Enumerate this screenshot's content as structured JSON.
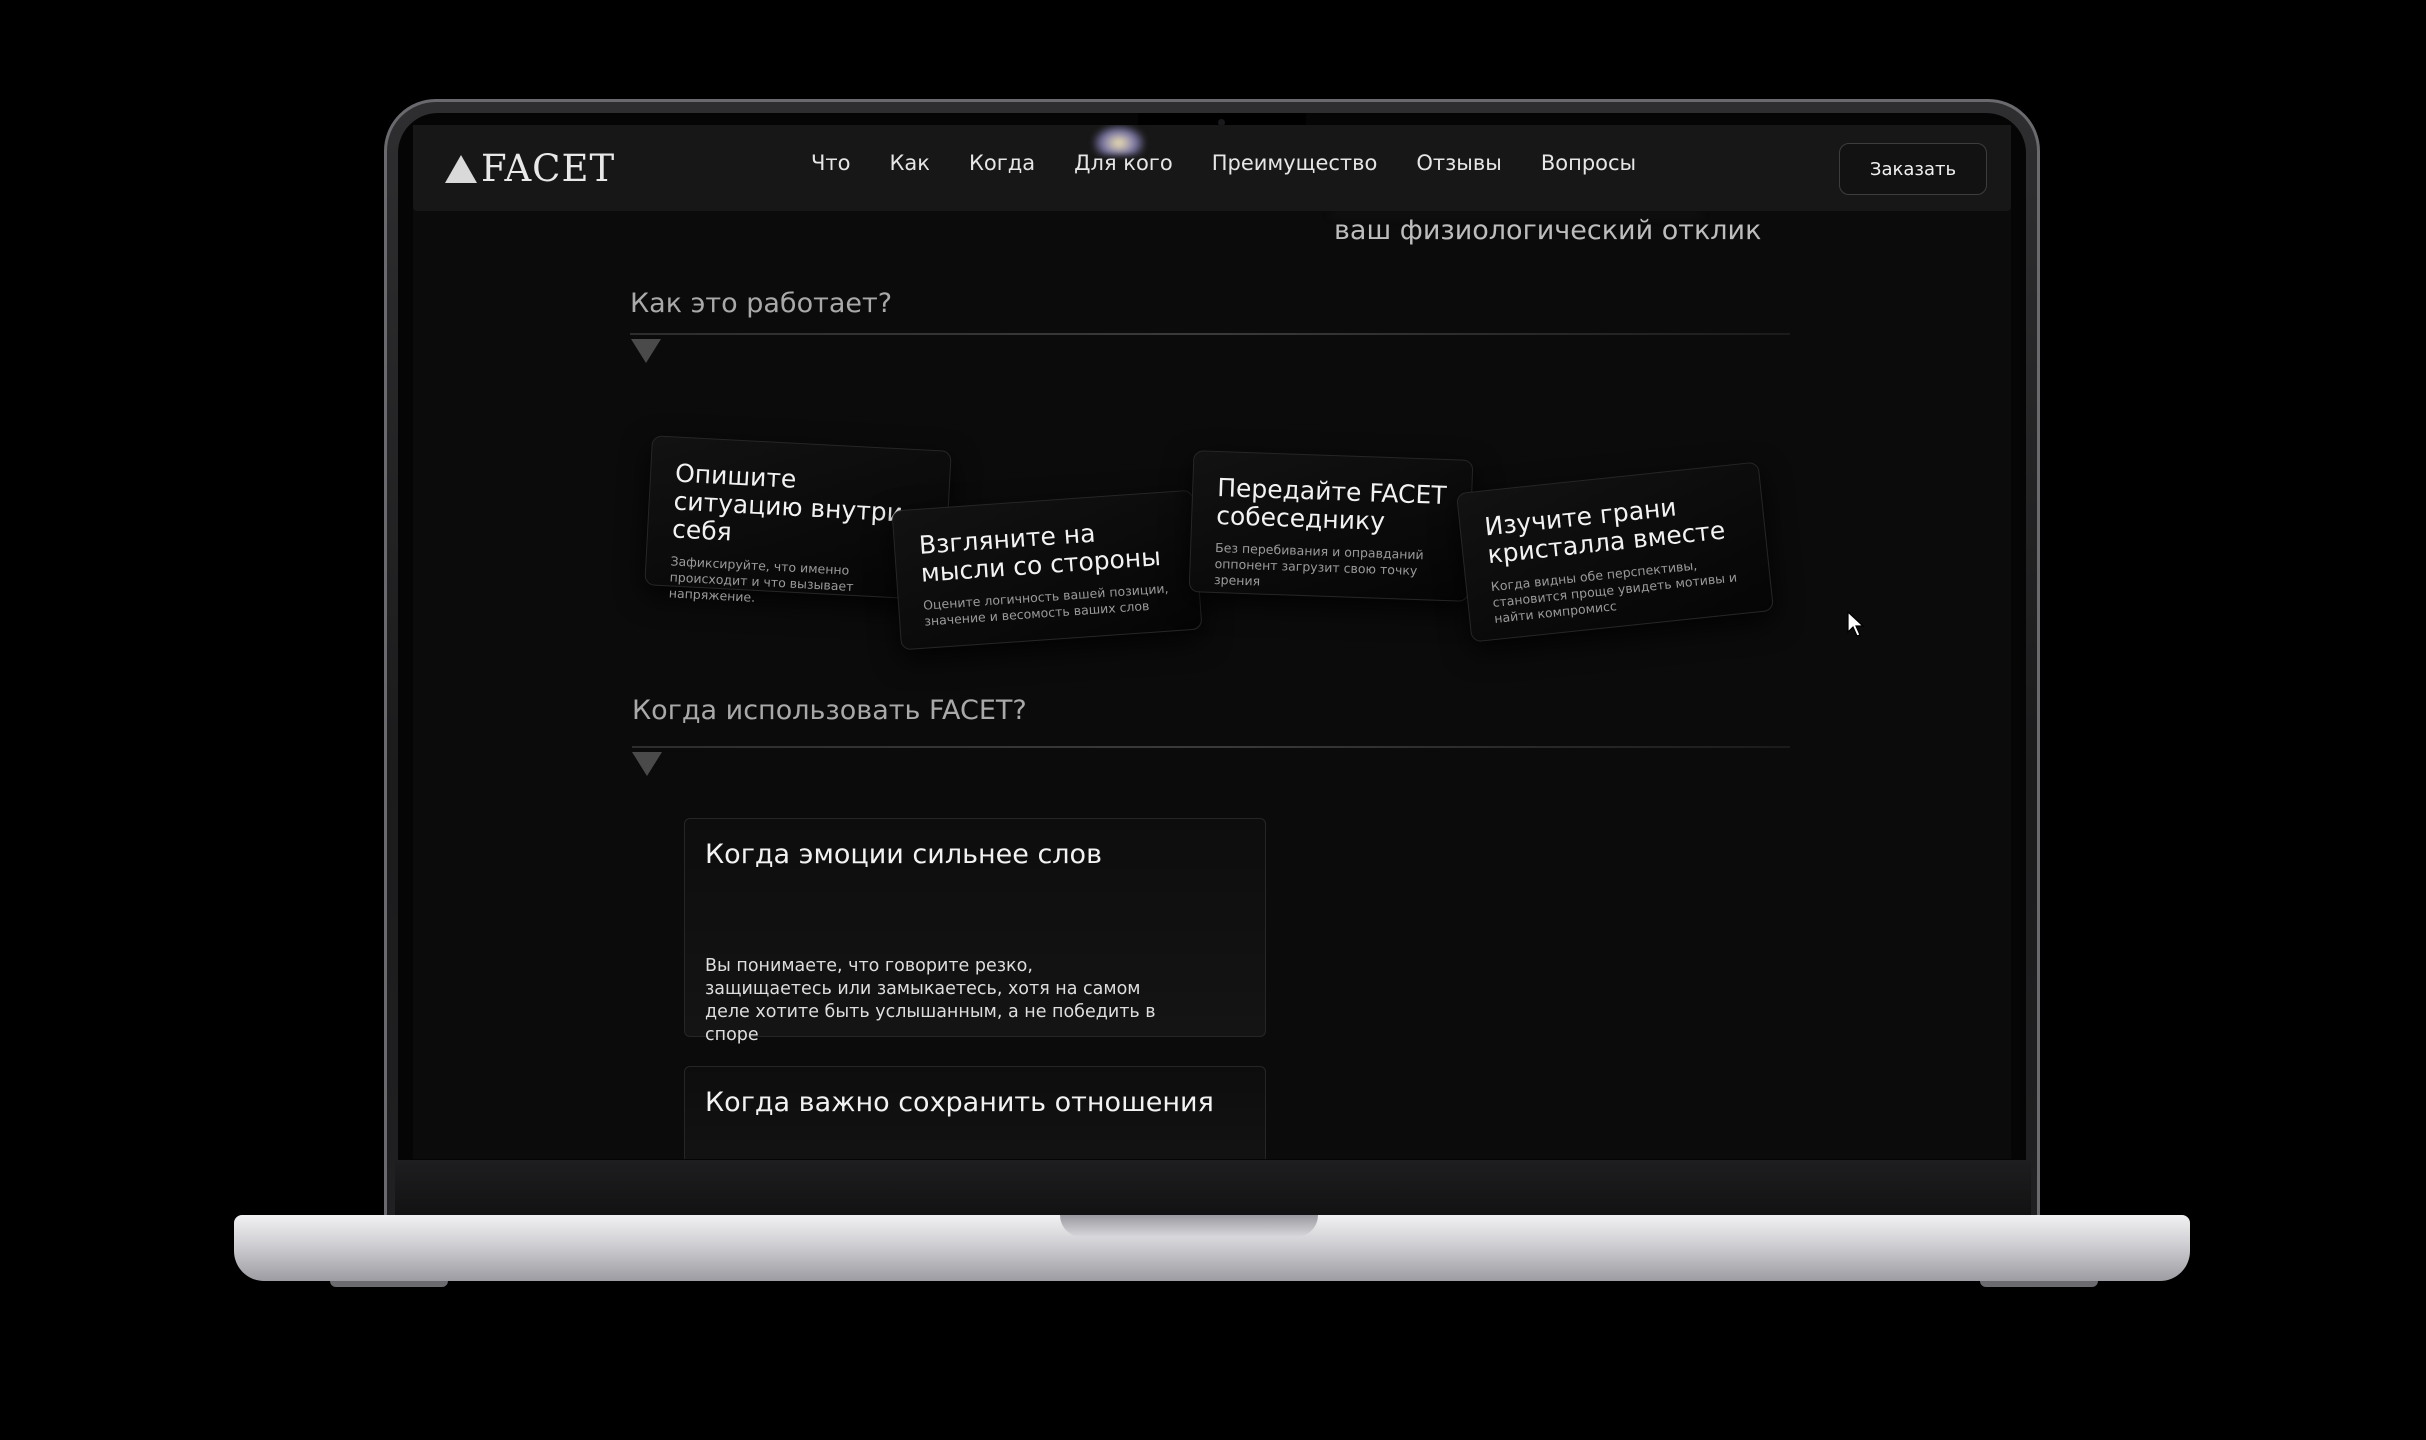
{
  "header": {
    "logo_text": "FACET",
    "nav": [
      "Что",
      "Как",
      "Когда",
      "Для кого",
      "Преимущество",
      "Отзывы",
      "Вопросы"
    ],
    "order_button": "Заказать"
  },
  "hero": {
    "tail_text": "ваш физиологический отклик"
  },
  "how_it_works": {
    "title": "Как это работает?",
    "steps": [
      {
        "title": "Опишите ситуацию внутри себя",
        "desc": "Зафиксируйте, что именно происходит и что вызывает напряжение."
      },
      {
        "title": "Взгляните на мысли со стороны",
        "desc": "Оцените логичность вашей позиции, значение и весомость ваших слов"
      },
      {
        "title": "Передайте FACET собеседнику",
        "desc": "Без перебивания и оправданий оппонент загрузит свою точку зрения"
      },
      {
        "title": "Изучите грани кристалла вместе",
        "desc": "Когда видны обе перспективы, становится проще увидеть мотивы и найти компромисс"
      }
    ]
  },
  "when_to_use": {
    "title": "Когда использовать FACET?",
    "cards": [
      {
        "title": "Когда эмоции сильнее слов",
        "desc": "Вы понимаете, что говорите резко, защищаетесь или замыкаетесь, хотя на самом деле хотите быть услышанным, а не победить в споре"
      },
      {
        "title": "Когда важно сохранить отношения",
        "desc": ""
      }
    ]
  },
  "colors": {
    "background": "#0b0b0b",
    "header": "#171717",
    "text": "#f2f2f2",
    "muted": "#a9a9a9"
  },
  "icons": [
    "logo-triangle-icon",
    "section-arrow-icon",
    "mouse-cursor-icon"
  ]
}
